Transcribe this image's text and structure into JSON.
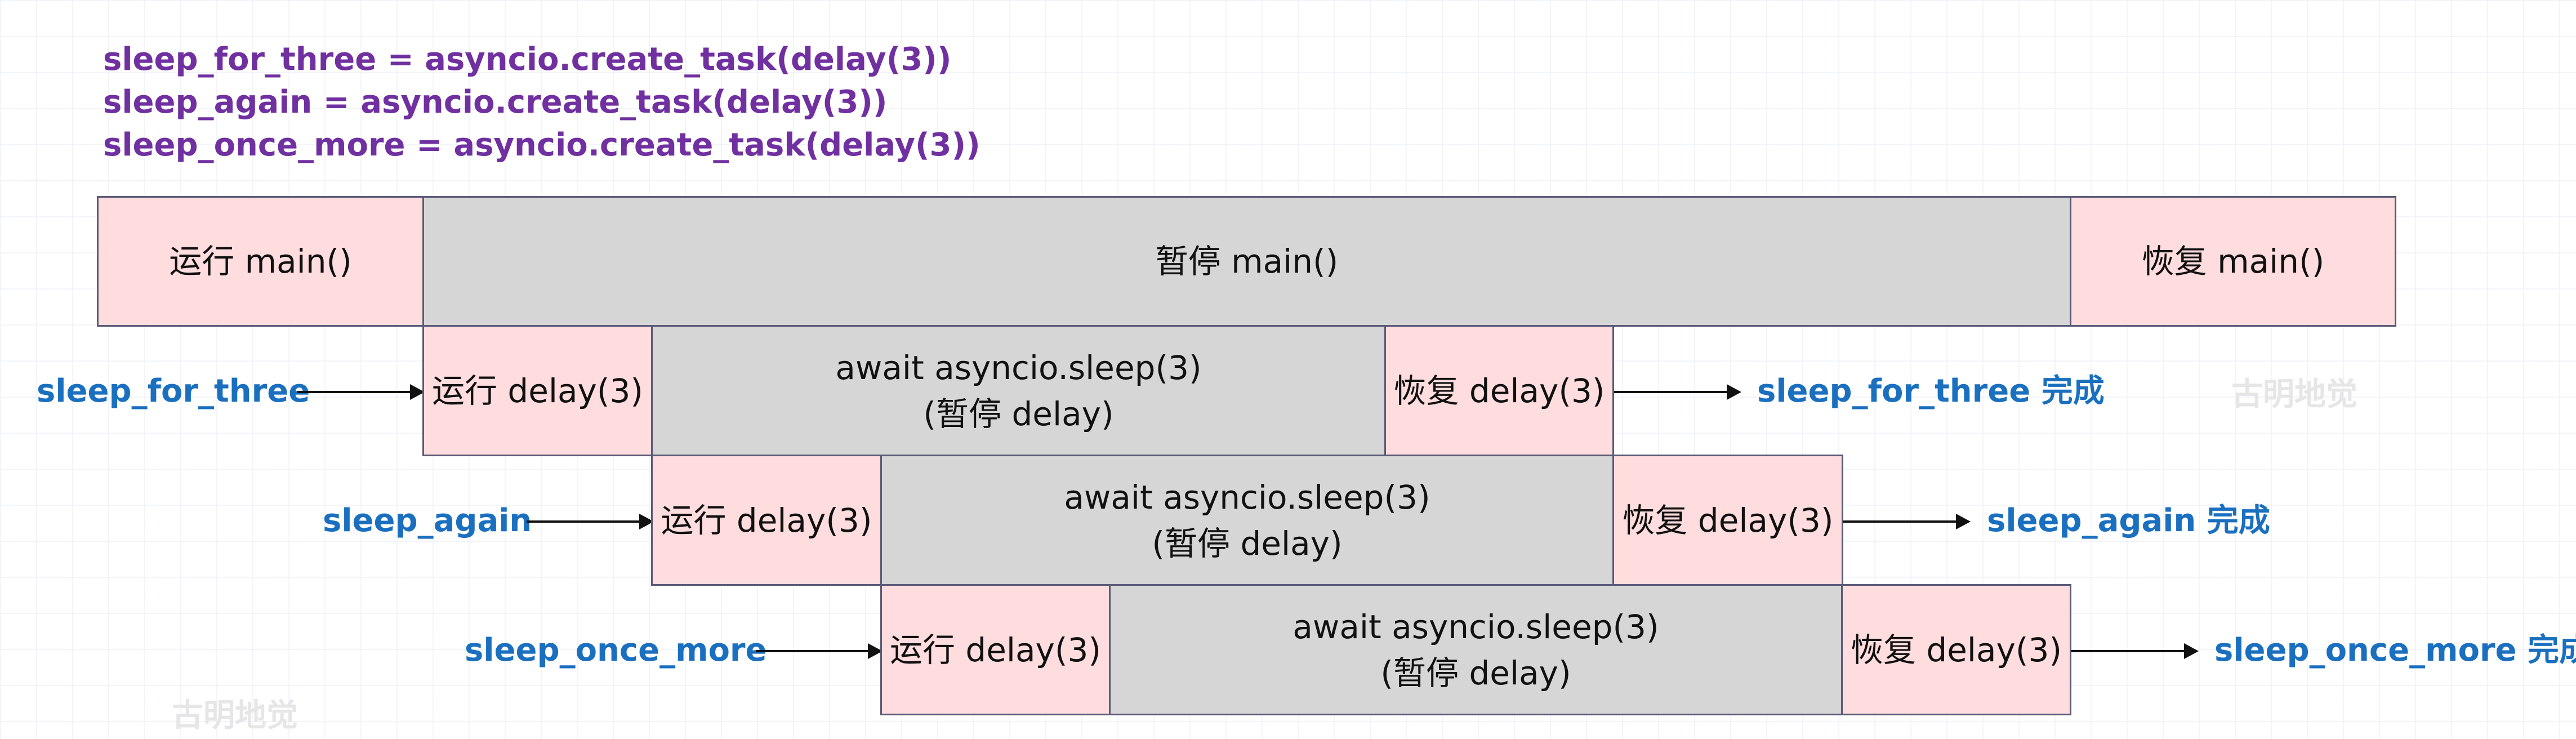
{
  "code_lines": [
    "sleep_for_three = asyncio.create_task(delay(3))",
    "sleep_again = asyncio.create_task(delay(3))",
    "sleep_once_more = asyncio.create_task(delay(3))"
  ],
  "main_row": {
    "run": "运行 main()",
    "pause": "暂停 main()",
    "resume": "恢复 main()"
  },
  "tasks": [
    {
      "name": "sleep_for_three",
      "run": "运行 delay(3)",
      "await_line1": "await asyncio.sleep(3)",
      "await_line2": "(暂停 delay)",
      "resume": "恢复 delay(3)",
      "done": "sleep_for_three 完成"
    },
    {
      "name": "sleep_again",
      "run": "运行 delay(3)",
      "await_line1": "await asyncio.sleep(3)",
      "await_line2": "(暂停 delay)",
      "resume": "恢复 delay(3)",
      "done": "sleep_again 完成"
    },
    {
      "name": "sleep_once_more",
      "run": "运行 delay(3)",
      "await_line1": "await asyncio.sleep(3)",
      "await_line2": "(暂停 delay)",
      "resume": "恢复 delay(3)",
      "done": "sleep_once_more 完成"
    }
  ],
  "watermarks": [
    "古明地觉",
    "古明地觉"
  ],
  "colors": {
    "code": "#7030a0",
    "label": "#1a6fbf",
    "active": "#ffdcdd",
    "paused": "#d6d6d6",
    "border": "#5a5a78"
  }
}
